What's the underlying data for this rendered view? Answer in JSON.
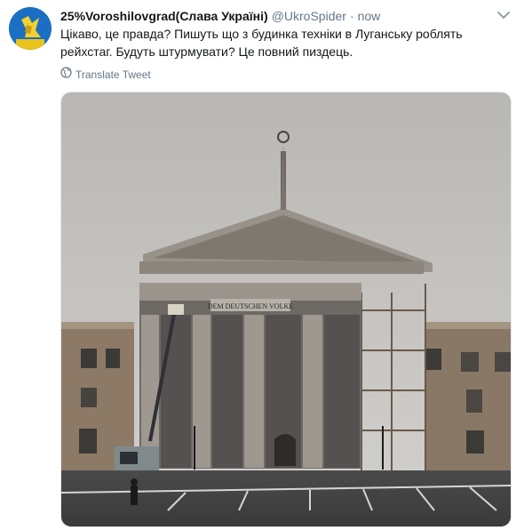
{
  "tweet": {
    "display_name": "25%Voroshilovgrad(Слава Україні)",
    "handle": "@UkroSpider",
    "separator": "·",
    "time": "now",
    "text_line1": "Цікаво, це правда? Пишуть що з будинка техніки в Луганську роблять",
    "text_line2": "рейхстаг. Будуть штурмувати? Це повний пиздець.",
    "translate_label": "Translate Tweet",
    "banner_text": "DEM DEUTSCHEN VOLKE"
  },
  "icons": {
    "caret": "chevron-down-icon",
    "translate": "globe-icon",
    "avatar": "avatar"
  },
  "colors": {
    "text": "#14171a",
    "muted": "#657786",
    "border": "#e1e8ed"
  }
}
